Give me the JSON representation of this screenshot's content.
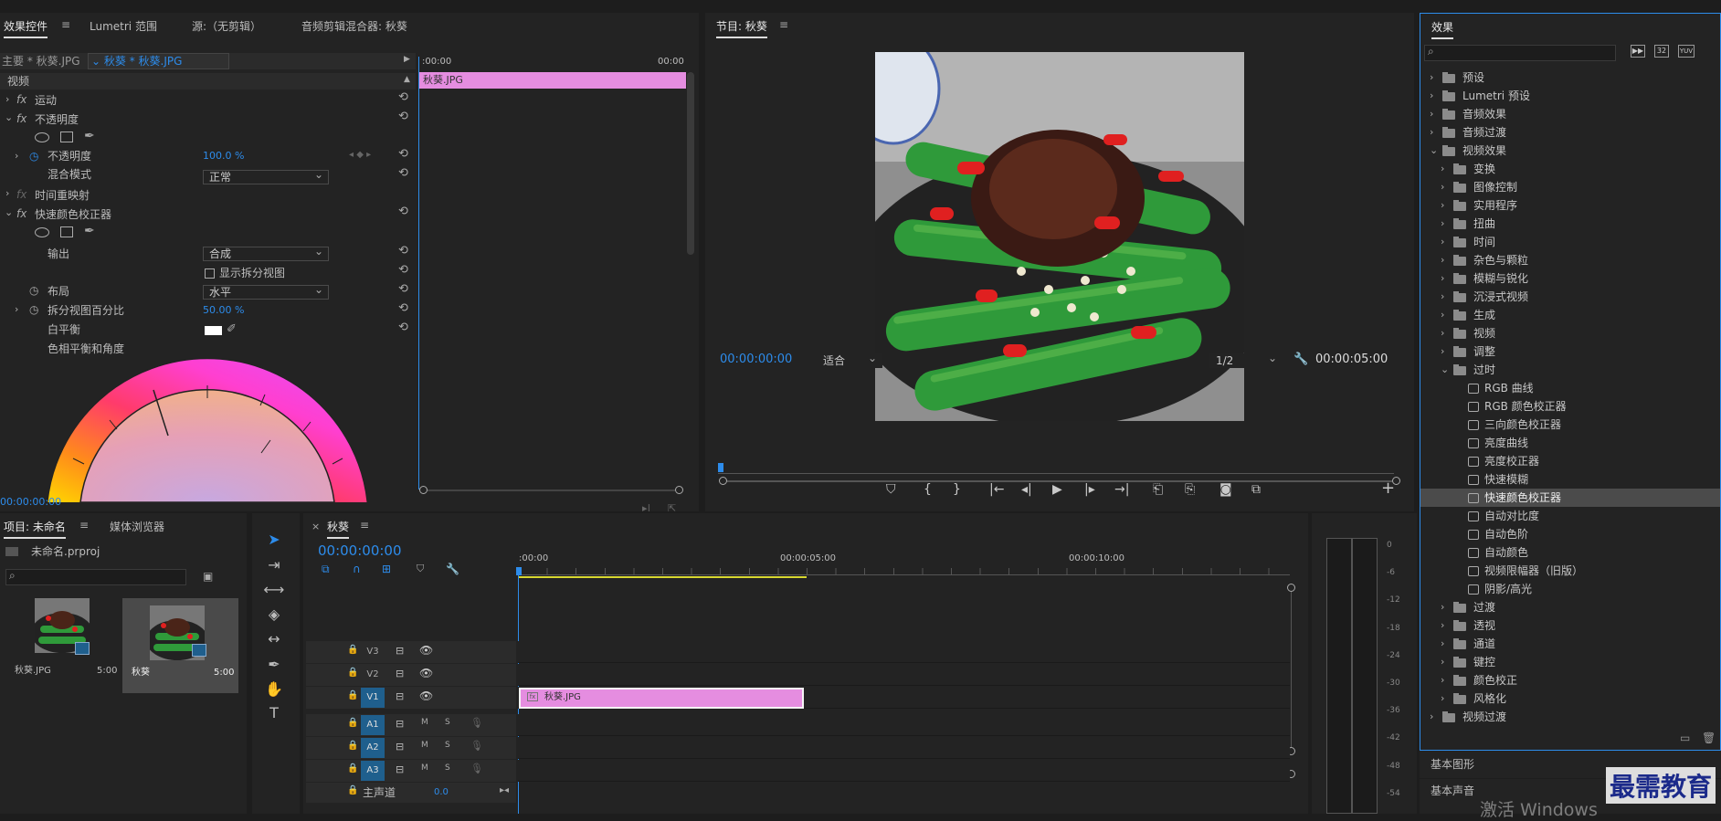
{
  "effect_controls": {
    "tabs": [
      "效果控件",
      "Lumetri 范围",
      "源:（无剪辑）",
      "音频剪辑混合器: 秋葵"
    ],
    "master_label": "主要 * 秋葵.JPG",
    "clip_label": "秋葵 * 秋葵.JPG",
    "time_start": ":00:00",
    "time_end": "00:00",
    "clip_bar": "秋葵.JPG",
    "section_video": "视频",
    "motion": "运动",
    "opacity": "不透明度",
    "opacity_param": "不透明度",
    "opacity_value": "100.0 %",
    "blend_mode": "混合模式",
    "blend_value": "正常",
    "time_remap": "时间重映射",
    "fast_color": "快速颜色校正器",
    "output": "输出",
    "output_value": "合成",
    "show_split": "显示拆分视图",
    "layout": "布局",
    "layout_value": "水平",
    "split_percent": "拆分视图百分比",
    "split_value": "50.00 %",
    "white_balance": "白平衡",
    "hue_balance": "色相平衡和角度",
    "timecode": "00:00:00:00",
    "fx": "fx"
  },
  "program": {
    "title": "节目: 秋葵",
    "timecode": "00:00:00:00",
    "fit": "适合",
    "resolution": "1/2",
    "duration": "00:00:05:00"
  },
  "effects_panel": {
    "title": "效果",
    "items": [
      {
        "label": "预设",
        "level": 0,
        "open": false
      },
      {
        "label": "Lumetri 预设",
        "level": 0,
        "open": false
      },
      {
        "label": "音频效果",
        "level": 0,
        "open": false
      },
      {
        "label": "音频过渡",
        "level": 0,
        "open": false
      },
      {
        "label": "视频效果",
        "level": 0,
        "open": true
      },
      {
        "label": "变换",
        "level": 1,
        "open": false
      },
      {
        "label": "图像控制",
        "level": 1,
        "open": false
      },
      {
        "label": "实用程序",
        "level": 1,
        "open": false
      },
      {
        "label": "扭曲",
        "level": 1,
        "open": false
      },
      {
        "label": "时间",
        "level": 1,
        "open": false
      },
      {
        "label": "杂色与颗粒",
        "level": 1,
        "open": false
      },
      {
        "label": "模糊与锐化",
        "level": 1,
        "open": false
      },
      {
        "label": "沉浸式视频",
        "level": 1,
        "open": false
      },
      {
        "label": "生成",
        "level": 1,
        "open": false
      },
      {
        "label": "视频",
        "level": 1,
        "open": false
      },
      {
        "label": "调整",
        "level": 1,
        "open": false
      },
      {
        "label": "过时",
        "level": 1,
        "open": true
      },
      {
        "label": "RGB 曲线",
        "level": 2
      },
      {
        "label": "RGB 颜色校正器",
        "level": 2
      },
      {
        "label": "三向颜色校正器",
        "level": 2
      },
      {
        "label": "亮度曲线",
        "level": 2
      },
      {
        "label": "亮度校正器",
        "level": 2
      },
      {
        "label": "快速模糊",
        "level": 2
      },
      {
        "label": "快速颜色校正器",
        "level": 2,
        "selected": true
      },
      {
        "label": "自动对比度",
        "level": 2
      },
      {
        "label": "自动色阶",
        "level": 2
      },
      {
        "label": "自动颜色",
        "level": 2
      },
      {
        "label": "视频限幅器（旧版）",
        "level": 2
      },
      {
        "label": "阴影/高光",
        "level": 2
      },
      {
        "label": "过渡",
        "level": 1,
        "open": false
      },
      {
        "label": "透视",
        "level": 1,
        "open": false
      },
      {
        "label": "通道",
        "level": 1,
        "open": false
      },
      {
        "label": "键控",
        "level": 1,
        "open": false
      },
      {
        "label": "颜色校正",
        "level": 1,
        "open": false
      },
      {
        "label": "风格化",
        "level": 1,
        "open": false
      },
      {
        "label": "视频过渡",
        "level": 0,
        "open": false
      }
    ],
    "basic_graphics": "基本图形",
    "basic_sound": "基本声音"
  },
  "project": {
    "tabs": [
      "项目: 未命名",
      "媒体浏览器"
    ],
    "file": "未命名.prproj",
    "items": [
      {
        "name": "秋葵.JPG",
        "duration": "5:00"
      },
      {
        "name": "秋葵",
        "duration": "5:00"
      }
    ]
  },
  "timeline": {
    "tab": "秋葵",
    "close": "×",
    "timecode": "00:00:00:00",
    "ruler": [
      ":00:00",
      "00:00:05:00",
      "00:00:10:00"
    ],
    "video_tracks": [
      "V3",
      "V2",
      "V1"
    ],
    "audio_tracks": [
      "A1",
      "A2",
      "A3"
    ],
    "m": "M",
    "s": "S",
    "master": "主声道",
    "master_value": "0.0",
    "clip": "秋葵.JPG"
  },
  "meter": {
    "labels": [
      "0",
      "-6",
      "-12",
      "-18",
      "-24",
      "-30",
      "-36",
      "-42",
      "-48",
      "-54"
    ]
  },
  "watermark": {
    "logo": "最需教育",
    "activate": "激活 Windows"
  }
}
